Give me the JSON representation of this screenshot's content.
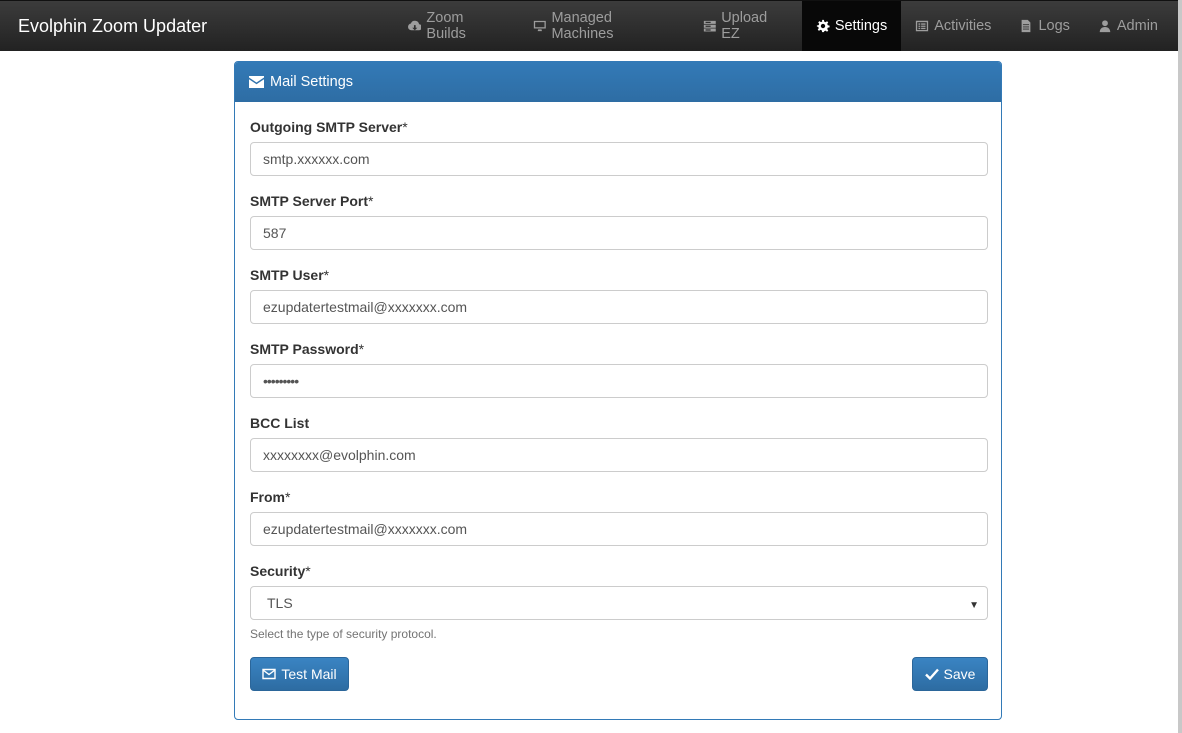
{
  "app": {
    "title": "Evolphin Zoom Updater"
  },
  "nav": {
    "items": [
      {
        "label": "Zoom Builds",
        "icon": "cloud-download-icon"
      },
      {
        "label": "Managed Machines",
        "icon": "desktop-icon"
      },
      {
        "label": "Upload EZ",
        "icon": "server-icon"
      },
      {
        "label": "Settings",
        "icon": "gear-icon",
        "active": true
      },
      {
        "label": "Activities",
        "icon": "list-alt-icon"
      },
      {
        "label": "Logs",
        "icon": "file-icon"
      },
      {
        "label": "Admin",
        "icon": "user-icon"
      }
    ]
  },
  "panel": {
    "title": "Mail Settings",
    "icon": "envelope-icon"
  },
  "form": {
    "smtp_server": {
      "label": "Outgoing SMTP Server",
      "required": "*",
      "value": "smtp.xxxxxx.com"
    },
    "smtp_port": {
      "label": "SMTP Server Port",
      "required": "*",
      "value": "587"
    },
    "smtp_user": {
      "label": "SMTP User",
      "required": "*",
      "value": "ezupdatertestmail@xxxxxxx.com"
    },
    "smtp_password": {
      "label": "SMTP Password",
      "required": "*",
      "value": "•••••••••"
    },
    "bcc_list": {
      "label": "BCC List",
      "required": "",
      "value": "xxxxxxxx@evolphin.com"
    },
    "from": {
      "label": "From",
      "required": "*",
      "value": "ezupdatertestmail@xxxxxxx.com"
    },
    "security": {
      "label": "Security",
      "required": "*",
      "value": "TLS",
      "help": "Select the type of security protocol."
    }
  },
  "buttons": {
    "test_mail": "Test Mail",
    "save": "Save"
  },
  "colors": {
    "primary": "#337ab7",
    "navbar": "#222222",
    "nav_text": "#9d9d9d"
  }
}
